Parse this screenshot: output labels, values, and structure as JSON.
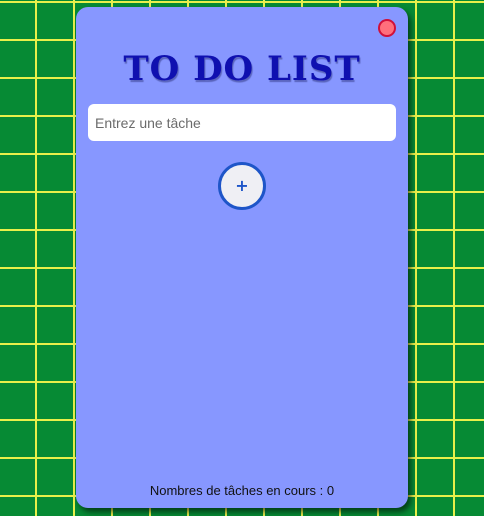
{
  "app": {
    "title": "TO DO LIST"
  },
  "input": {
    "placeholder": "Entrez une tâche",
    "value": ""
  },
  "add_button": {
    "label": "+"
  },
  "tasks": [],
  "counter": {
    "label": "Nombres de tâches en cours : ",
    "count": "0"
  },
  "colors": {
    "background": "#068a34",
    "grid_lines": "#e8f04a",
    "card": "#8797ff",
    "title": "#0f10b0",
    "add_button_border": "#1e55c8",
    "close_dot": "#ff6f7c"
  },
  "icons": {
    "close": "close-dot-icon"
  }
}
